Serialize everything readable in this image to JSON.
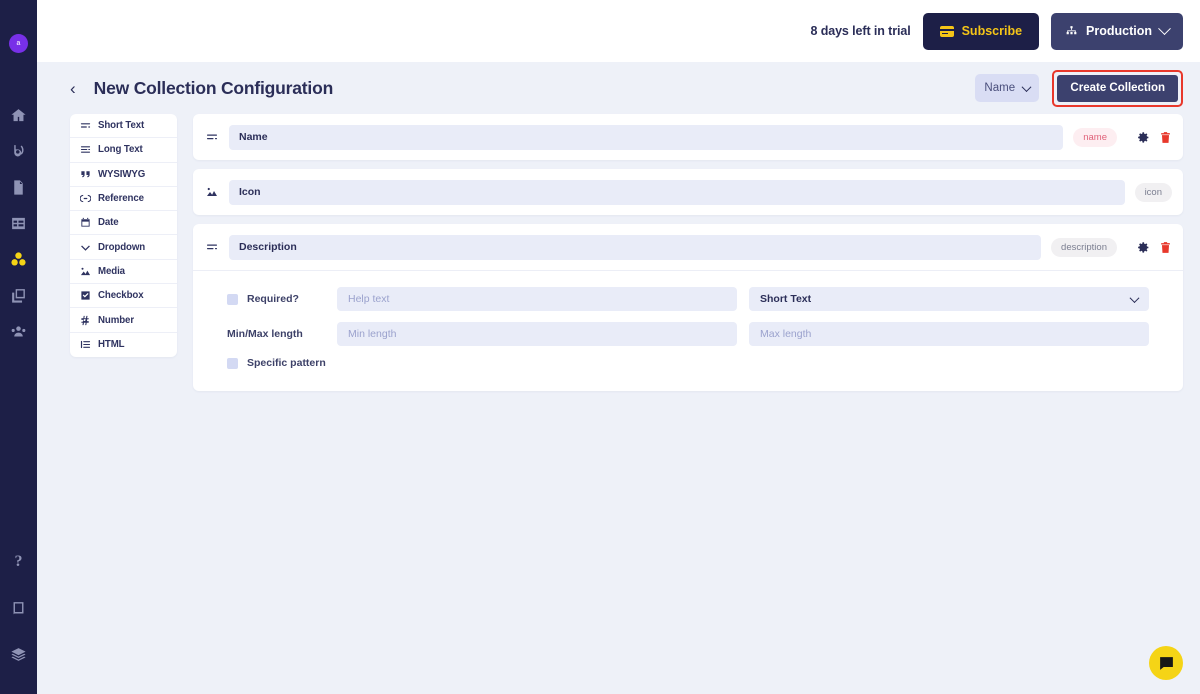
{
  "rail": {
    "avatar_initial": "a",
    "top_icons": [
      {
        "name": "home-icon"
      },
      {
        "name": "broadcast-icon"
      },
      {
        "name": "document-icon"
      },
      {
        "name": "table-icon"
      },
      {
        "name": "collections-icon"
      },
      {
        "name": "media-library-icon"
      },
      {
        "name": "team-icon"
      }
    ],
    "bottom_icons": [
      {
        "name": "help-icon",
        "glyph": "?"
      },
      {
        "name": "book-icon"
      },
      {
        "name": "layers-icon"
      }
    ]
  },
  "topbar": {
    "trial_text": "8 days left in trial",
    "subscribe_label": "Subscribe",
    "environment_label": "Production"
  },
  "pagehead": {
    "back_label": "‹",
    "title": "New Collection Configuration",
    "sort_value": "Name",
    "create_label": "Create Collection"
  },
  "type_list": [
    {
      "label": "Short Text",
      "icon": "short-text-icon"
    },
    {
      "label": "Long Text",
      "icon": "long-text-icon"
    },
    {
      "label": "WYSIWYG",
      "icon": "quote-icon"
    },
    {
      "label": "Reference",
      "icon": "link-icon"
    },
    {
      "label": "Date",
      "icon": "calendar-icon"
    },
    {
      "label": "Dropdown",
      "icon": "chevron-down-icon"
    },
    {
      "label": "Media",
      "icon": "image-icon"
    },
    {
      "label": "Checkbox",
      "icon": "checkbox-icon"
    },
    {
      "label": "Number",
      "icon": "hash-icon"
    },
    {
      "label": "HTML",
      "icon": "list-icon"
    }
  ],
  "fields": [
    {
      "name_value": "Name",
      "slug": "name",
      "slug_style": "accent",
      "drag_icon": "short-text-icon",
      "has_actions": true,
      "expanded": false
    },
    {
      "name_value": "Icon",
      "slug": "icon",
      "slug_style": "plain",
      "drag_icon": "image-icon",
      "has_actions": false,
      "expanded": false
    },
    {
      "name_value": "Description",
      "slug": "description",
      "slug_style": "plain",
      "drag_icon": "short-text-icon",
      "has_actions": true,
      "expanded": true
    }
  ],
  "settings": {
    "required_label": "Required?",
    "help_text_placeholder": "Help text",
    "field_type_value": "Short Text",
    "minmax_label": "Min/Max length",
    "min_length_placeholder": "Min length",
    "max_length_placeholder": "Max length",
    "specific_pattern_label": "Specific pattern"
  },
  "chat": {
    "icon": "chat-bubble-icon"
  },
  "colors": {
    "rail_bg": "#1d1f47",
    "page_bg": "#eef1f8",
    "accent_yellow": "#f5d416",
    "accent_purple": "#7830e8",
    "danger_red": "#e8382b",
    "button_navy": "#3c416e",
    "badge_pink_bg": "#fdeef1",
    "badge_pink_fg": "#e0637a"
  }
}
